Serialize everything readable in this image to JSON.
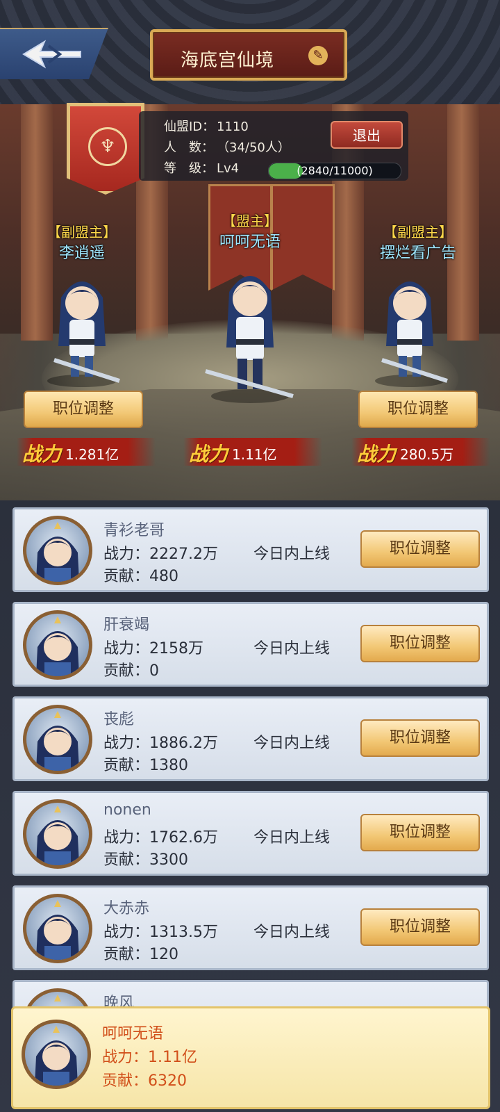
{
  "header": {
    "title": "海底宫仙境"
  },
  "guild": {
    "id_label": "仙盟ID：",
    "id_value": "1110",
    "members_label": "人　数：",
    "members_value": "（34/50人）",
    "level_label": "等　级：",
    "level_value": "Lv4",
    "exp_text": "(2840/11000)",
    "exp_fraction": 0.258,
    "exit_label": "退出"
  },
  "leaders": [
    {
      "role": "【副盟主】",
      "name": "李逍遥",
      "power_icon": "战力",
      "power": "1.281亿",
      "button": "职位调整"
    },
    {
      "role": "【盟主】",
      "name": "呵呵无语",
      "power_icon": "战力",
      "power": "1.11亿"
    },
    {
      "role": "【副盟主】",
      "name": "摆烂看广告",
      "power_icon": "战力",
      "power": "280.5万",
      "button": "职位调整"
    }
  ],
  "members": [
    {
      "name": "青衫老哥",
      "power": "战力：2227.2万",
      "status": "今日内上线",
      "contrib": "贡献：480",
      "button": "职位调整"
    },
    {
      "name": "肝衰竭",
      "power": "战力：2158万",
      "status": "今日内上线",
      "contrib": "贡献：0",
      "button": "职位调整"
    },
    {
      "name": "丧彪",
      "power": "战力：1886.2万",
      "status": "今日内上线",
      "contrib": "贡献：1380",
      "button": "职位调整"
    },
    {
      "name": "nonen",
      "power": "战力：1762.6万",
      "status": "今日内上线",
      "contrib": "贡献：3300",
      "button": "职位调整"
    },
    {
      "name": "大赤赤",
      "power": "战力：1313.5万",
      "status": "今日内上线",
      "contrib": "贡献：120",
      "button": "职位调整"
    },
    {
      "name": "晚风"
    }
  ],
  "me": {
    "name": "呵呵无语",
    "power": "战力：1.11亿",
    "contrib": "贡献：6320"
  }
}
